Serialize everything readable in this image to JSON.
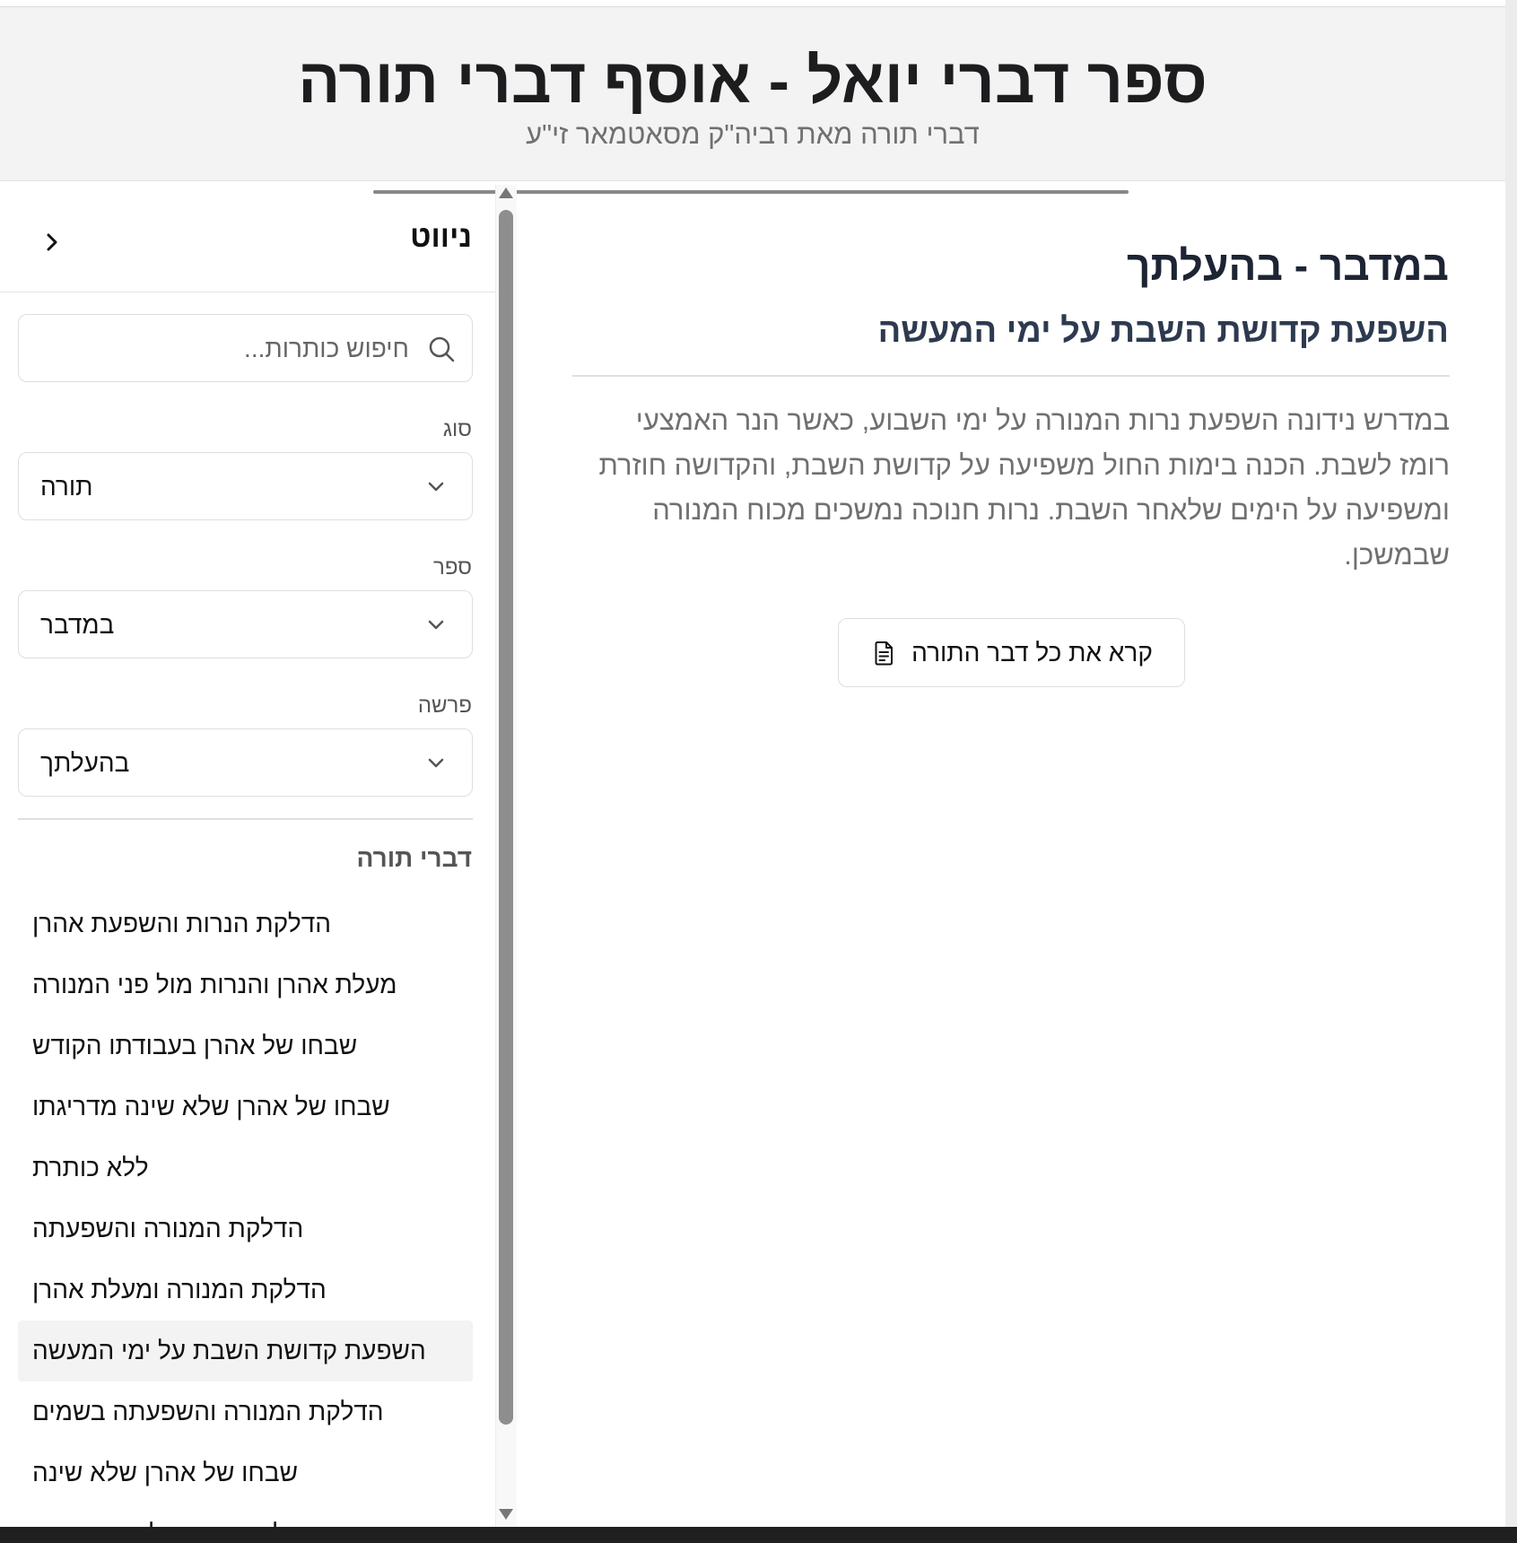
{
  "header": {
    "title": "ספר דברי יואל - אוסף דברי תורה",
    "subtitle": "דברי תורה מאת רביה\"ק מסאטמאר זי\"ע"
  },
  "sidebar": {
    "title": "ניווט",
    "collapse_icon": "chevron-right-icon",
    "search": {
      "placeholder": "חיפוש כותרות...",
      "value": "",
      "icon": "search-icon"
    },
    "filters": [
      {
        "label": "סוג",
        "value": "תורה"
      },
      {
        "label": "ספר",
        "value": "במדבר"
      },
      {
        "label": "פרשה",
        "value": "בהעלתך"
      }
    ],
    "list_heading": "דברי תורה",
    "items": [
      {
        "label": "הדלקת הנרות והשפעת אהרן",
        "active": false
      },
      {
        "label": "מעלת אהרן והנרות מול פני המנורה",
        "active": false
      },
      {
        "label": "שבחו של אהרן בעבודתו הקודש",
        "active": false
      },
      {
        "label": "שבחו של אהרן שלא שינה מדריגתו",
        "active": false
      },
      {
        "label": "ללא כותרת",
        "active": false
      },
      {
        "label": "הדלקת המנורה והשפעתה",
        "active": false
      },
      {
        "label": "הדלקת המנורה ומעלת אהרן",
        "active": false
      },
      {
        "label": "השפעת קדושת השבת על ימי המעשה",
        "active": true
      },
      {
        "label": "הדלקת המנורה והשפעתה בשמים",
        "active": false
      },
      {
        "label": "שבחו של אהרן שלא שינה",
        "active": false
      },
      {
        "label": "שבחו של אהרן בהדלקת המנורה",
        "active": false
      }
    ]
  },
  "main": {
    "title": "במדבר - בהעלתך",
    "subtitle": "השפעת קדושת השבת על ימי המעשה",
    "body": "במדרש נידונה השפעת נרות המנורה על ימי השבוע, כאשר הנר האמצעי רומז לשבת. הכנה בימות החול משפיעה על קדושת השבת, והקדושה חוזרת ומשפיעה על הימים שלאחר השבת. נרות חנוכה נמשכים מכוח המנורה שבמשכן.",
    "read_button": {
      "label": "קרא את כל דבר התורה",
      "icon": "document-icon"
    }
  },
  "colors": {
    "header_bg": "#f3f3f3",
    "title": "#1d2433",
    "muted_text": "#707070",
    "active_item_bg": "#f3f3f3",
    "scroll_thumb": "#8e8e8e"
  }
}
